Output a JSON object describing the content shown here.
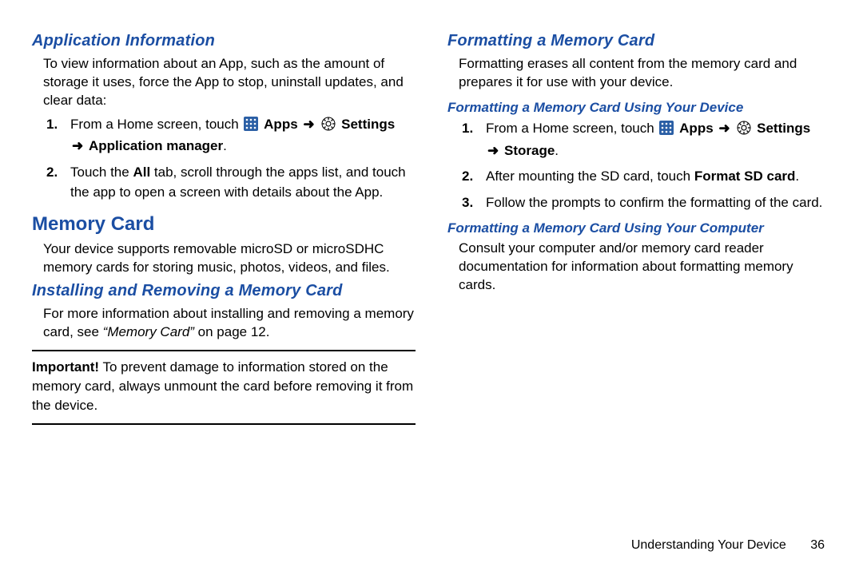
{
  "left": {
    "h_app_info": "Application Information",
    "app_info_text": "To view information about an App, such as the amount of storage it uses, force the App to stop, uninstall updates, and clear data:",
    "step1_pre": "From a Home screen, touch ",
    "apps_label": "Apps",
    "settings_label": "Settings",
    "step1_tail": "Application manager",
    "step2_a": "Touch the ",
    "step2_all": "All",
    "step2_b": " tab, scroll through the apps list, and touch the app to open a screen with details about the App.",
    "h_memory": "Memory Card",
    "memory_intro": "Your device supports removable microSD or microSDHC memory cards for storing music, photos, videos, and files.",
    "h_install": "Installing and Removing a Memory Card",
    "install_a": "For more information about installing and removing a memory card, see ",
    "install_ref": "“Memory Card”",
    "install_b": " on page 12.",
    "important_label": "Important!",
    "important_text": "To prevent damage to information stored on the memory card, always unmount the card before removing it from the device."
  },
  "right": {
    "h_format": "Formatting a Memory Card",
    "format_intro": "Formatting erases all content from the memory card and prepares it for use with your device.",
    "h_format_device": "Formatting a Memory Card Using Your Device",
    "step1_pre": "From a Home screen, touch ",
    "apps_label": "Apps",
    "settings_label": "Settings",
    "step1_tail": "Storage",
    "step2_a": "After mounting the SD card, touch ",
    "step2_b": "Format SD card",
    "step3": "Follow the prompts to confirm the formatting of the card.",
    "h_format_computer": "Formatting a Memory Card Using Your Computer",
    "computer_text": "Consult your computer and/or memory card reader documentation for information about formatting memory cards."
  },
  "footer": {
    "section": "Understanding Your Device",
    "page": "36"
  },
  "glyphs": {
    "arrow": "➜",
    "dot": "."
  }
}
